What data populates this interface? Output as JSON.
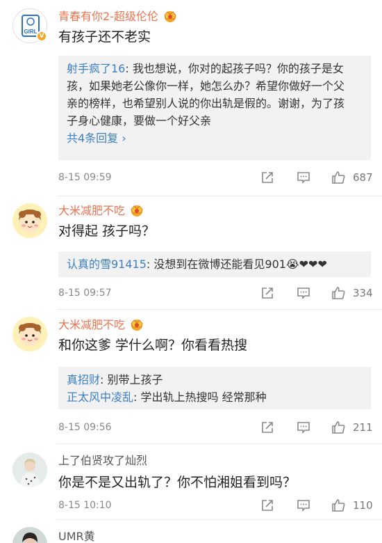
{
  "comments": [
    {
      "user": "青春有你2-超级伦伦",
      "text": "有孩子还不老实",
      "avatar_icon": "girl-logo-avatar",
      "verified_badge": "V",
      "replies": [
        {
          "name": "射手疯了16",
          "text": "我也想说，你对的起孩子吗？你的孩子是女"
        },
        {
          "name": "",
          "text": "孩，如果她老公像你一样，她怎么办？希望你做好一个父"
        },
        {
          "name": "",
          "text": "亲的榜样，也希望别人说的你出轨是假的。谢谢，为了孩"
        },
        {
          "name": "",
          "text": "子身心健康，要做一个好父亲"
        }
      ],
      "more_replies": "共4条回复 ›",
      "time": "8-15 09:59",
      "likes": "687"
    },
    {
      "user": "大米减肥不吃",
      "text": "对得起 孩子吗？",
      "avatar_icon": "cartoon-girl-avatar",
      "replies": [
        {
          "name": "认真的雪91415",
          "text": "没想到在微博还能看见901😭❤❤❤"
        }
      ],
      "time": "8-15 09:57",
      "likes": "334"
    },
    {
      "user": "大米减肥不吃",
      "text": "和你这爹 学什么啊？你看看热搜",
      "avatar_icon": "cartoon-girl-avatar",
      "replies": [
        {
          "name": "真招财",
          "text": "别带上孩子"
        },
        {
          "name": "正太风中凌乱",
          "text": "学出轨上热搜吗 经常那种"
        }
      ],
      "time": "8-15 09:56",
      "likes": "211"
    },
    {
      "user": "上了伯贤攻了灿烈",
      "text": "你是不是又出轨了？你不怕湘姐看到吗？",
      "avatar_icon": "person-photo-avatar",
      "time": "8-15 10:10",
      "likes": "110"
    },
    {
      "user": "UMR黄",
      "avatar_icon": "person-photo-avatar"
    }
  ],
  "colors": {
    "username_vip": "#eb7350",
    "reply_name": "#3a7fc4",
    "reply_bg": "#f2f2f2",
    "meta_gray": "#888888",
    "crown_gold": "#f5a623"
  }
}
